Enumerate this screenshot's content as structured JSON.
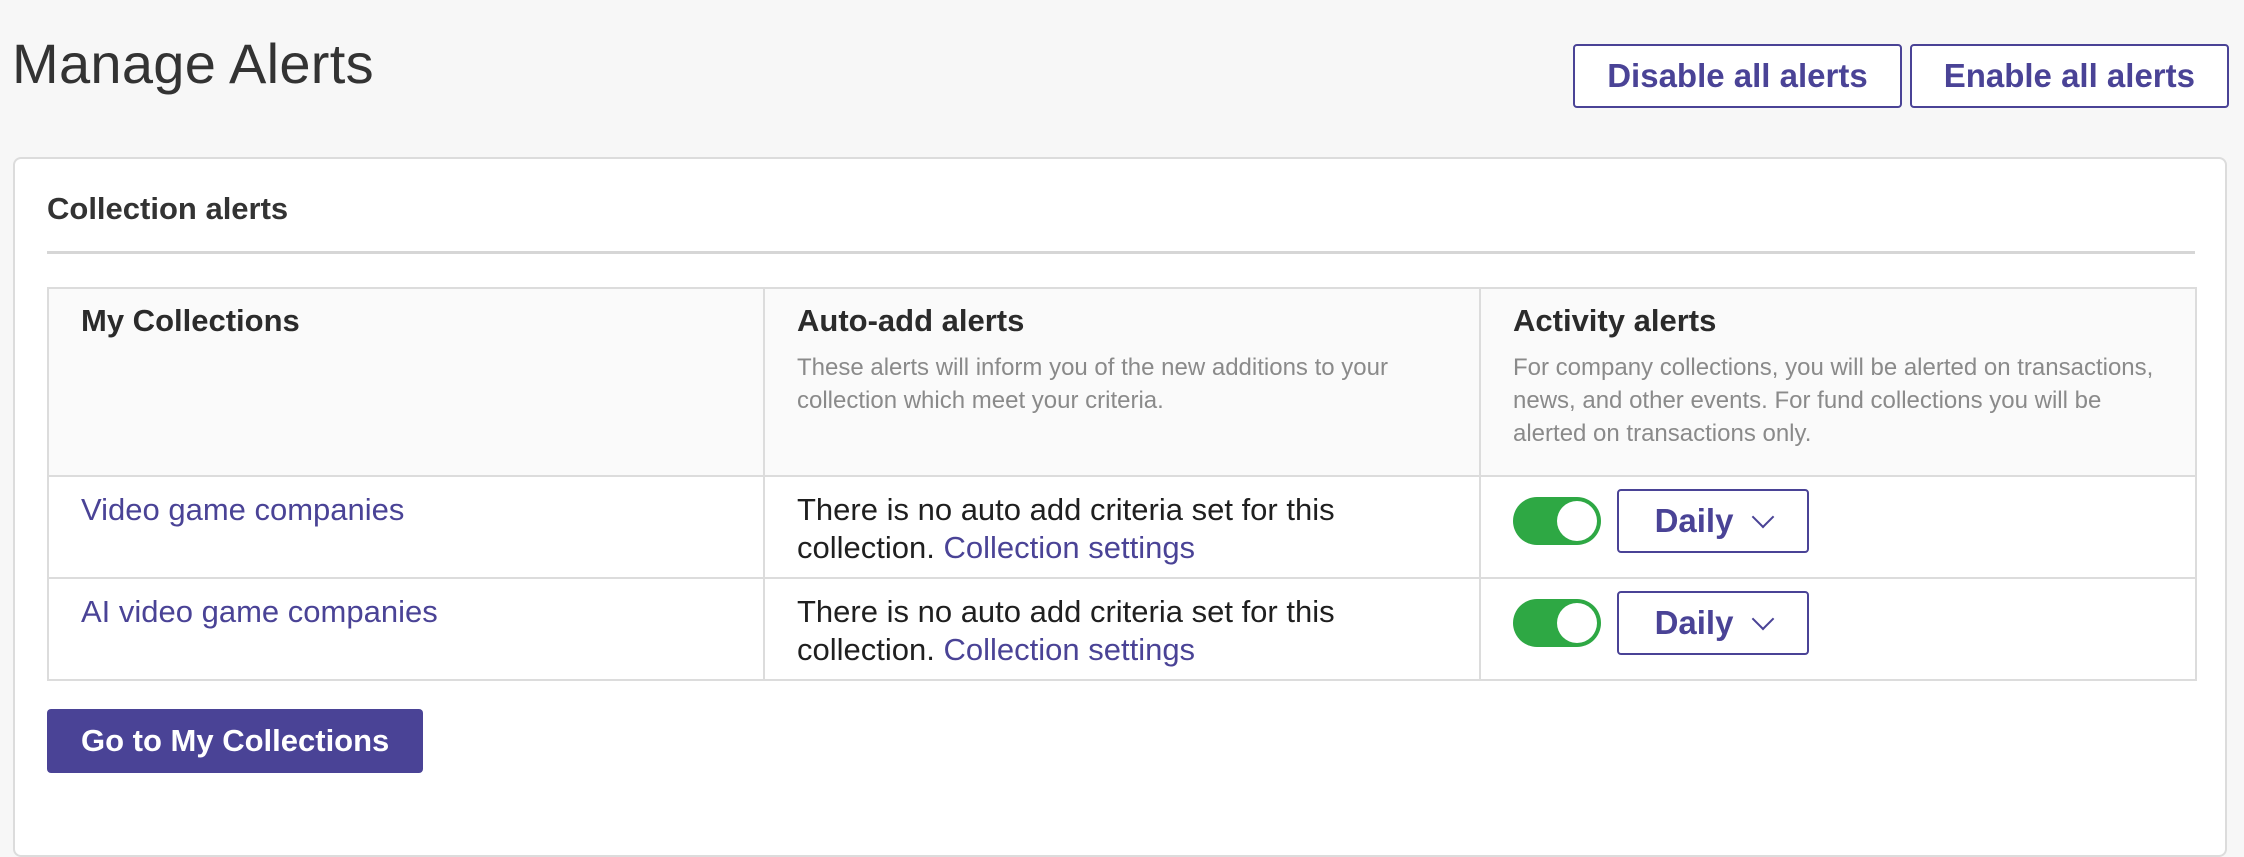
{
  "header": {
    "title": "Manage Alerts",
    "disable_all_label": "Disable all alerts",
    "enable_all_label": "Enable all alerts"
  },
  "panel": {
    "heading": "Collection alerts"
  },
  "table": {
    "columns": [
      {
        "title": "My Collections",
        "description": ""
      },
      {
        "title": "Auto-add alerts",
        "description": "These alerts will inform you of the new additions to your collection which meet your criteria."
      },
      {
        "title": "Activity alerts",
        "description": "For company collections, you will be alerted on transactions, news, and other events. For fund collections you will be alerted on transactions only."
      }
    ],
    "rows": [
      {
        "name": "Video game companies",
        "criteria_text": "There is no auto add criteria set for this collection.",
        "settings_link": "Collection settings",
        "activity_enabled": true,
        "frequency": "Daily"
      },
      {
        "name": "AI video game companies",
        "criteria_text": "There is no auto add criteria set for this collection.",
        "settings_link": "Collection settings",
        "activity_enabled": true,
        "frequency": "Daily"
      }
    ]
  },
  "footer": {
    "go_to_collections_label": "Go to My Collections"
  },
  "icons": {
    "frequency_dropdown": "chevron-down-icon"
  },
  "colors": {
    "accent": "#4a4396",
    "toggle_on": "#2ea844",
    "background": "#f7f7f7"
  }
}
